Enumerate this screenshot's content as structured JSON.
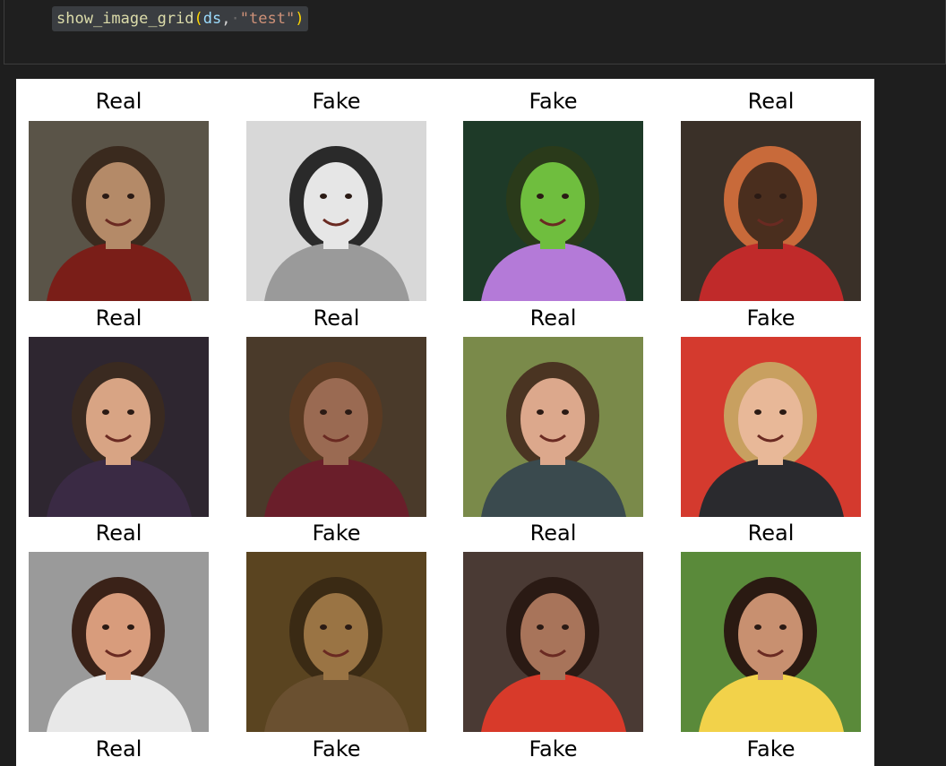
{
  "cell": {
    "code": {
      "fn": "show_image_grid",
      "open": "(",
      "arg1": "ds",
      "comma": ",",
      "dot": "·",
      "arg2": "\"test\"",
      "close": ")"
    }
  },
  "grid": {
    "top_labels": [
      "Real",
      "Fake",
      "Fake",
      "Real"
    ],
    "rows": [
      {
        "images": [
          {
            "label": "Real",
            "icon": "man-scarf-photo",
            "bg": "#5a5448",
            "skin": "#b48a68",
            "hair": "#3a2a1e",
            "clothes": "#7a1e18"
          },
          {
            "label": "Real",
            "icon": "woman-grayscale-photo",
            "bg": "#d8d8d8",
            "skin": "#e6e6e6",
            "hair": "#2a2a2a",
            "clothes": "#9a9a9a"
          },
          {
            "label": "Real",
            "icon": "two-boys-green-photo",
            "bg": "#1e3a28",
            "skin": "#6fbe3e",
            "hair": "#2a3a1a",
            "clothes": "#b47ad8"
          },
          {
            "label": "Fake",
            "icon": "group-smiling-photo",
            "bg": "#3a3028",
            "skin": "#4a2e1e",
            "hair": "#c86a3a",
            "clothes": "#c02a2a"
          }
        ]
      },
      {
        "images": [
          {
            "label": "Real",
            "icon": "graduate-photo",
            "bg": "#2e2630",
            "skin": "#d8a484",
            "hair": "#3a2a20",
            "clothes": "#3a2a44"
          },
          {
            "label": "Fake",
            "icon": "woman-brown-photo",
            "bg": "#4a3a2a",
            "skin": "#9a6a52",
            "hair": "#5a3a22",
            "clothes": "#6a1e2a"
          },
          {
            "label": "Real",
            "icon": "woman-autumn-photo",
            "bg": "#7a8a4a",
            "skin": "#dca88c",
            "hair": "#4a3422",
            "clothes": "#3a4a4e"
          },
          {
            "label": "Real",
            "icon": "blonde-woman-red-photo",
            "bg": "#d43a2e",
            "skin": "#e8b898",
            "hair": "#c8a060",
            "clothes": "#2a2a2e"
          }
        ]
      },
      {
        "images": [
          {
            "label": "Real",
            "icon": "woman-smiling-photo",
            "bg": "#9a9a9a",
            "skin": "#d89c7c",
            "hair": "#3a2218",
            "clothes": "#e8e8e8"
          },
          {
            "label": "Fake",
            "icon": "sepia-selfie-photo",
            "bg": "#5a4420",
            "skin": "#9a7444",
            "hair": "#3a2a14",
            "clothes": "#6a5030"
          },
          {
            "label": "Fake",
            "icon": "child-striped-photo",
            "bg": "#4a3a34",
            "skin": "#a8745a",
            "hair": "#2a1a14",
            "clothes": "#d83a2a"
          },
          {
            "label": "Fake",
            "icon": "mother-daughter-photo",
            "bg": "#5a8a3a",
            "skin": "#c89070",
            "hair": "#2a1a12",
            "clothes": "#f2d24a"
          }
        ]
      }
    ]
  }
}
